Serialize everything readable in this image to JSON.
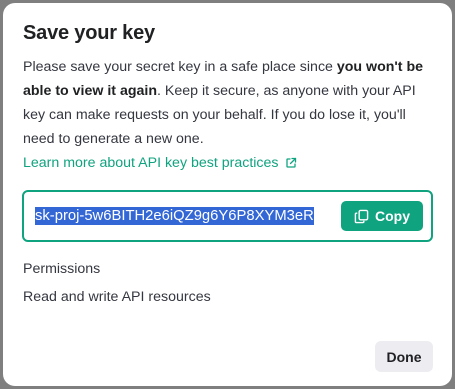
{
  "dialog": {
    "title": "Save your key",
    "description_prefix": "Please save your secret key in a safe place since ",
    "description_bold": "you won't be able to view it again",
    "description_suffix": ". Keep it secure, as anyone with your API key can make requests on your behalf. If you do lose it, you'll need to generate a new one.",
    "learn_more_link": "Learn more about API key best practices",
    "secret_key_value": "sk-proj-5w6BITH2e6iQZ9g6Y6P8XYM3eR",
    "copy_button_label": "Copy",
    "permissions_heading": "Permissions",
    "permissions_value": "Read and write API resources",
    "done_button_label": "Done"
  },
  "colors": {
    "accent": "#10a37f",
    "selection": "#3467d6",
    "done_bg": "#ececf1"
  },
  "icons": {
    "external_link": "external-link-icon",
    "copy": "copy-icon"
  }
}
